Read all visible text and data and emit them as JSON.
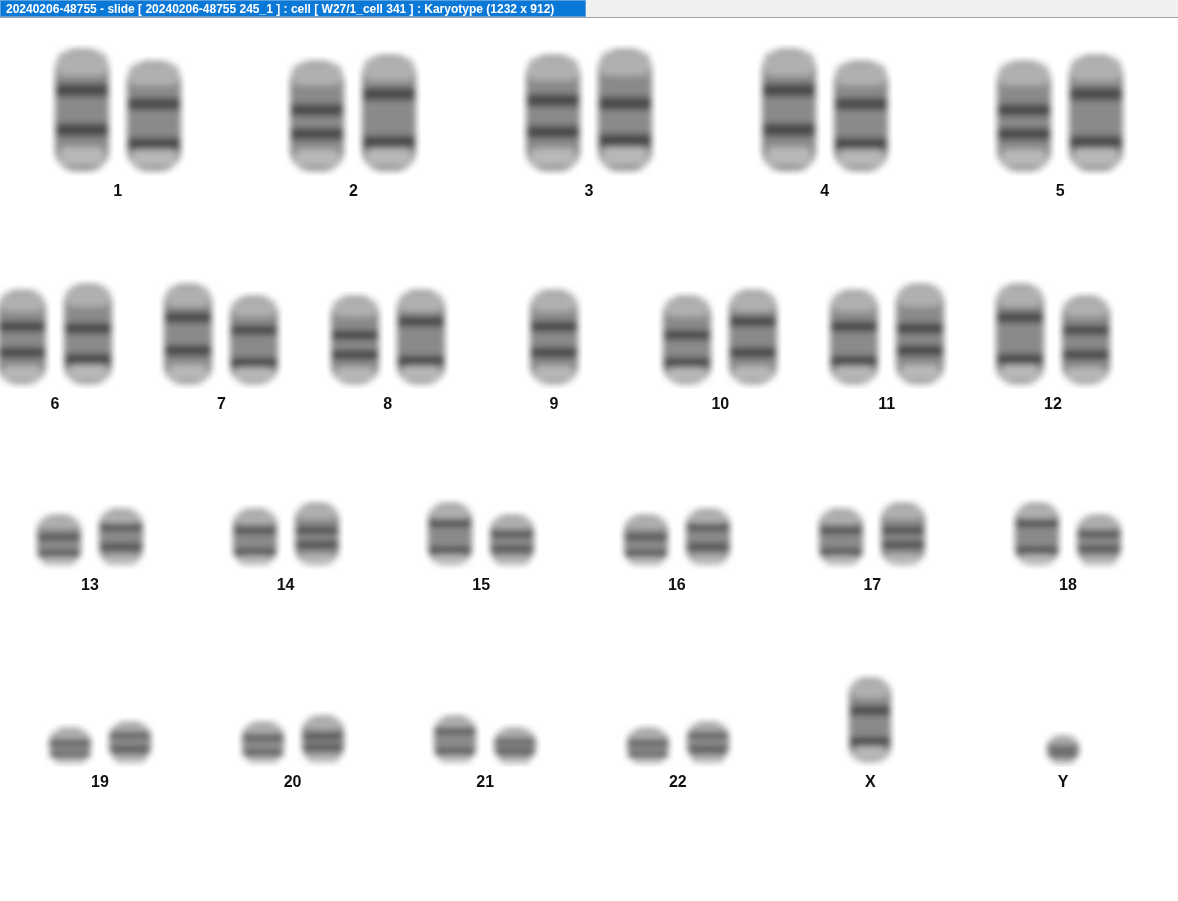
{
  "window": {
    "title": "20240206-48755 - slide [ 20240206-48755 245_1 ] : cell [ W27/1_cell 341 ] : Karyotype  (1232 x 912)"
  },
  "rows": [
    {
      "groups": [
        {
          "label": "1",
          "kind": "pair"
        },
        {
          "label": "2",
          "kind": "pair"
        },
        {
          "label": "3",
          "kind": "pair"
        },
        {
          "label": "4",
          "kind": "pair"
        },
        {
          "label": "5",
          "kind": "pair"
        }
      ]
    },
    {
      "groups": [
        {
          "label": "6",
          "kind": "pair"
        },
        {
          "label": "7",
          "kind": "pair"
        },
        {
          "label": "8",
          "kind": "pair"
        },
        {
          "label": "9",
          "kind": "single"
        },
        {
          "label": "10",
          "kind": "pair"
        },
        {
          "label": "11",
          "kind": "pair"
        },
        {
          "label": "12",
          "kind": "pair"
        }
      ]
    },
    {
      "groups": [
        {
          "label": "13",
          "kind": "pair"
        },
        {
          "label": "14",
          "kind": "pair"
        },
        {
          "label": "15",
          "kind": "pair"
        },
        {
          "label": "16",
          "kind": "pair"
        },
        {
          "label": "17",
          "kind": "pair"
        },
        {
          "label": "18",
          "kind": "pair"
        }
      ]
    },
    {
      "groups": [
        {
          "label": "19",
          "kind": "pair"
        },
        {
          "label": "20",
          "kind": "pair"
        },
        {
          "label": "21",
          "kind": "pair"
        },
        {
          "label": "22",
          "kind": "pair"
        },
        {
          "label": "X",
          "kind": "single"
        },
        {
          "label": "Y",
          "kind": "single"
        }
      ]
    }
  ]
}
